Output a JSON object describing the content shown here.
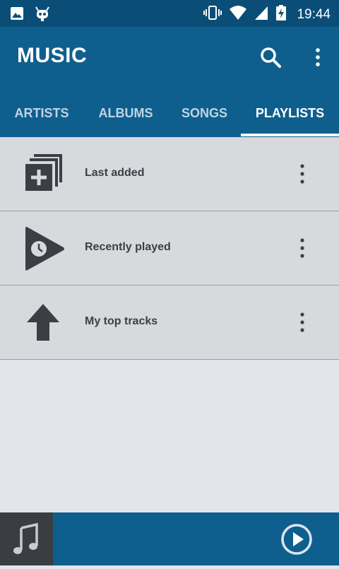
{
  "status_bar": {
    "time": "19:44",
    "icons": [
      "image-icon",
      "cyanogen-bot-icon",
      "vibrate-icon",
      "wifi-icon",
      "signal-icon",
      "battery-charging-icon"
    ]
  },
  "app_bar": {
    "title": "MUSIC",
    "search_icon": "search-icon",
    "overflow_icon": "more-vert-icon"
  },
  "tabs": [
    {
      "label": "ARTISTS",
      "active": false
    },
    {
      "label": "ALBUMS",
      "active": false
    },
    {
      "label": "SONGS",
      "active": false
    },
    {
      "label": "PLAYLISTS",
      "active": true
    }
  ],
  "playlists": [
    {
      "label": "Last added",
      "icon": "library-add-icon"
    },
    {
      "label": "Recently played",
      "icon": "recent-play-icon"
    },
    {
      "label": "My top tracks",
      "icon": "arrow-up-icon"
    }
  ],
  "now_playing": {
    "art_icon": "music-note-icon",
    "play_icon": "play-circle-icon"
  },
  "colors": {
    "status_bar": "#0a4e77",
    "primary": "#0f5f8e",
    "list_bg": "#d7d9dc",
    "page_bg": "#e2e6ea",
    "icon": "#3b3f45"
  }
}
